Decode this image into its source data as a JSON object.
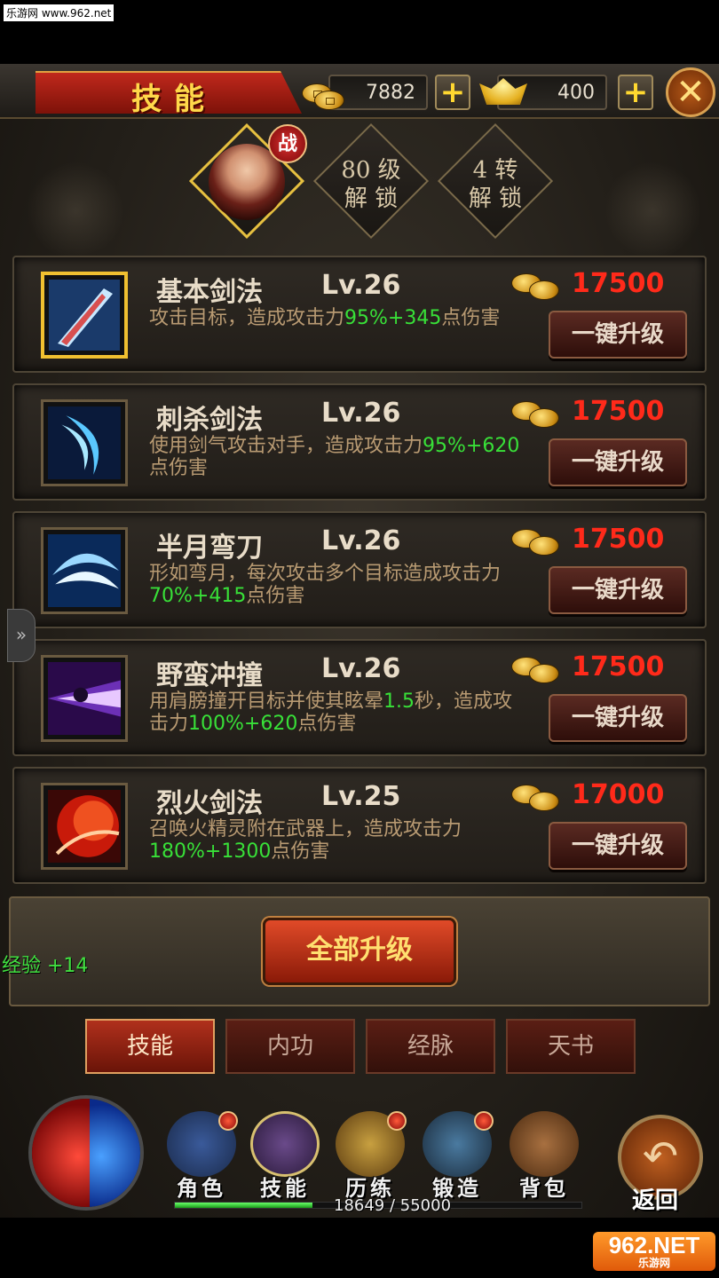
{
  "watermark_top": "乐游网 www.962.net",
  "header": {
    "title": "技能",
    "gold": "7882",
    "ingot": "400",
    "plus_symbol": "+",
    "close_symbol": "✕"
  },
  "portraits": {
    "badge": "战",
    "lock1_line1": "80 级",
    "lock1_line2": "解 锁",
    "lock2_line1": "4 转",
    "lock2_line2": "解 锁"
  },
  "skills": [
    {
      "name": "基本剑法",
      "level": "Lv.26",
      "cost": "17500",
      "desc_a": "攻击目标，造成攻击力",
      "desc_hl": "95%+345",
      "desc_b": "点伤害",
      "button": "一键升级",
      "icon": "sword-slash-icon"
    },
    {
      "name": "刺杀剑法",
      "level": "Lv.26",
      "cost": "17500",
      "desc_a": "使用剑气攻击对手，造成攻击力",
      "desc_hl": "95%+620",
      "desc_b": "点伤害",
      "button": "一键升级",
      "icon": "blade-wave-icon"
    },
    {
      "name": "半月弯刀",
      "level": "Lv.26",
      "cost": "17500",
      "desc_a": "形如弯月，每次攻击多个目标造成攻击力",
      "desc_hl": "70%+415",
      "desc_b": "点伤害",
      "button": "一键升级",
      "icon": "crescent-blade-icon"
    },
    {
      "name": "野蛮冲撞",
      "level": "Lv.26",
      "cost": "17500",
      "desc_a": "用肩膀撞开目标并使其眩晕",
      "desc_hl": "1.5",
      "desc_b": "秒，造成攻击力",
      "desc_hl2": "100%+620",
      "desc_c": "点伤害",
      "button": "一键升级",
      "icon": "charge-icon"
    },
    {
      "name": "烈火剑法",
      "level": "Lv.25",
      "cost": "17000",
      "desc_a": "召唤火精灵附在武器上，造成攻击力",
      "desc_hl": "180%+1300",
      "desc_b": "点伤害",
      "button": "一键升级",
      "icon": "fire-sword-icon"
    }
  ],
  "side_tab_symbol": "»",
  "all_upgrade": "全部升级",
  "exp_toast": "经验 +14",
  "tabs": [
    "技能",
    "内功",
    "经脉",
    "天书"
  ],
  "nav": [
    "角色",
    "技能",
    "历练",
    "锻造",
    "背包"
  ],
  "back": {
    "label": "返回",
    "symbol": "↶"
  },
  "exp": {
    "text": "18649 / 55000",
    "current": 18649,
    "max": 55000
  },
  "watermark_bottom": {
    "main": "962.NET",
    "sub": "乐游网"
  },
  "colors": {
    "cost": "#ff2a1a",
    "highlight": "#38e038",
    "title": "#ffd84a"
  }
}
